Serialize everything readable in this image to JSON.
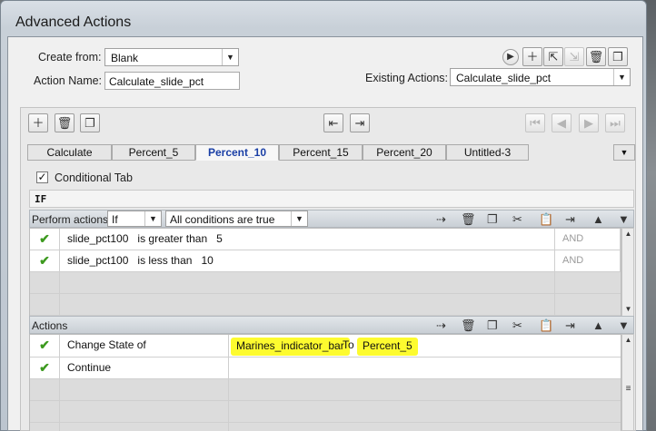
{
  "window": {
    "title": "Advanced Actions"
  },
  "form": {
    "create_from_label": "Create from:",
    "create_from_value": "Blank",
    "action_name_label": "Action Name:",
    "action_name_value": "Calculate_slide_pct",
    "existing_actions_label": "Existing Actions:",
    "existing_actions_value": "Calculate_slide_pct"
  },
  "tabs": [
    "Calculate",
    "Percent_5",
    "Percent_10",
    "Percent_15",
    "Percent_20",
    "Untitled-3"
  ],
  "active_tab": "Percent_10",
  "conditional_tab_label": "Conditional Tab",
  "conditional_tab_checked": true,
  "if_label": "IF",
  "perform": {
    "label": "Perform actions:",
    "mode": "If",
    "condition_mode": "All conditions are true"
  },
  "conditions": [
    {
      "variable": "slide_pct100",
      "operator": "is greater than",
      "value": "5",
      "logic": "AND"
    },
    {
      "variable": "slide_pct100",
      "operator": "is less than",
      "value": "10",
      "logic": "AND"
    }
  ],
  "actions_label": "Actions",
  "actions": [
    {
      "command": "Change State of",
      "target": "Marines_indicator_bar",
      "to_label": "To",
      "state": "Percent_5"
    },
    {
      "command": "Continue",
      "target": "",
      "to_label": "",
      "state": ""
    }
  ],
  "colors": {
    "highlight": "#fdfb2f",
    "active_tab_text": "#1a3fa6",
    "check_green": "#3d9a1f"
  }
}
